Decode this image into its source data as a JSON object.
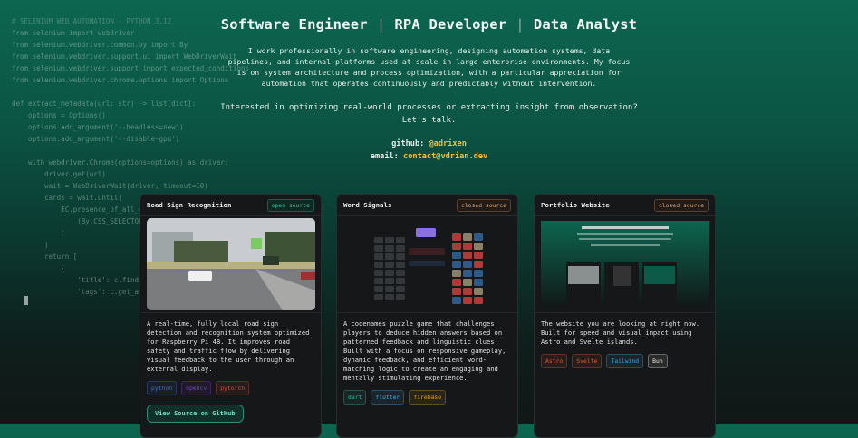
{
  "background_code": [
    "# SELENIUM WEB AUTOMATION - PYTHON 3.12",
    "from selenium import webdriver",
    "from selenium.webdriver.common.by import By",
    "from selenium.webdriver.support.ui import WebDriverWait",
    "from selenium.webdriver.support import expected_conditions",
    "from selenium.webdriver.chrome.options import Options",
    "",
    "def extract_metadata(url: str) -> list[dict]:",
    "    options = Options()",
    "    options.add_argument('--headless=new')",
    "    options.add_argument('--disable-gpu')",
    "",
    "    with webdriver.Chrome(options=options) as driver:",
    "        driver.get(url)",
    "        wait = WebDriverWait(driver, timeout=10)",
    "        cards = wait.until(",
    "            EC.presence_of_all_e",
    "                (By.CSS_SELECTOR",
    "            )",
    "        )",
    "        return [",
    "            {",
    "                'title': c.find_",
    "                'tags': c.get_at"
  ],
  "hero": {
    "roles": [
      "Software Engineer",
      "RPA Developer",
      "Data Analyst"
    ],
    "separator": "|",
    "bio": "I work professionally in software engineering, designing automation systems, data pipelines, and internal platforms used at scale in large enterprise environments. My focus is on system architecture and process optimization, with a particular appreciation for automation that operates continuously and predictably without intervention.",
    "cta_line1": "Interested in optimizing real-world processes or extracting insight from observation?",
    "cta_line2": "Let's talk.",
    "github_label": "github:",
    "github_value": "@adrixen",
    "email_label": "email:",
    "email_value": "contact@vdrian.dev"
  },
  "projects": [
    {
      "name": "Road Sign Recognition",
      "badge": "open source",
      "description": "A real-time, fully local road sign detection and recognition system optimized for Raspberry Pi 4B. It improves road safety and traffic flow by delivering visual feedback to the user through an external display.",
      "tags": [
        {
          "label": "python",
          "color": "#3b6fd0"
        },
        {
          "label": "opencv",
          "color": "#7a3fd0"
        },
        {
          "label": "pytorch",
          "color": "#d0503b"
        }
      ],
      "button": "View Source on GitHub"
    },
    {
      "name": "Word Signals",
      "badge": "closed source",
      "description": "A codenames puzzle game that challenges players to deduce hidden answers based on patterned feedback and linguistic clues. Built with a focus on responsive gameplay, dynamic feedback, and efficient word-matching logic to create an engaging and mentally stimulating experience.",
      "tags": [
        {
          "label": "dart",
          "color": "#2fb99a"
        },
        {
          "label": "flutter",
          "color": "#4aa8e0"
        },
        {
          "label": "firebase",
          "color": "#e0a020"
        }
      ]
    },
    {
      "name": "Portfolio Website",
      "badge": "closed source",
      "description": "The website you are looking at right now. Built for speed and visual impact using Astro and Svelte islands.",
      "tags": [
        {
          "label": "Astro",
          "color": "#e0552f"
        },
        {
          "label": "Svelte",
          "color": "#e0552f"
        },
        {
          "label": "Tailwind",
          "color": "#38a8e0"
        },
        {
          "label": "Bun",
          "color": "#e8e4dc"
        }
      ]
    }
  ]
}
